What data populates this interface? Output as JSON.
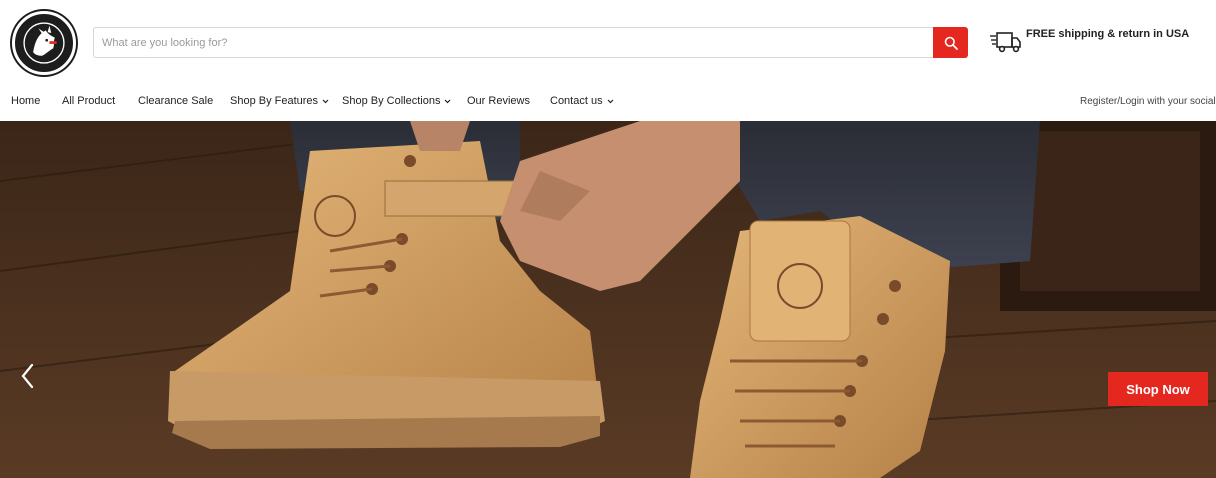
{
  "header": {
    "search": {
      "placeholder": "What are you looking for?",
      "value": ""
    },
    "shipping_text": "FREE shipping & return in USA",
    "brand_color": "#e4281f"
  },
  "nav": {
    "items": [
      {
        "label": "Home",
        "dropdown": false
      },
      {
        "label": "All Product",
        "dropdown": false
      },
      {
        "label": "Clearance Sale",
        "dropdown": false
      },
      {
        "label": "Shop By Features",
        "dropdown": true
      },
      {
        "label": "Shop By Collections",
        "dropdown": true
      },
      {
        "label": "Our Reviews",
        "dropdown": false
      },
      {
        "label": "Contact us",
        "dropdown": true
      }
    ],
    "account_link": "Register/Login with your social"
  },
  "hero": {
    "cta_label": "Shop Now",
    "prev_icon": "chevron-left-icon"
  }
}
